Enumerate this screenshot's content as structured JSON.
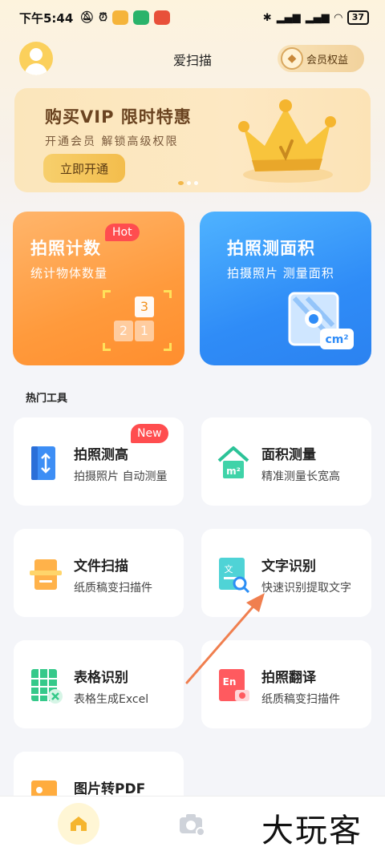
{
  "status_bar": {
    "time": "下午5:44",
    "battery": "37"
  },
  "header": {
    "title": "爱扫描",
    "vip_label": "会员权益"
  },
  "banner": {
    "title": "购买VIP 限时特惠",
    "subtitle": "开通会员 解锁高级权限",
    "button_label": "立即开通"
  },
  "feature_cards": [
    {
      "title": "拍照计数",
      "subtitle": "统计物体数量",
      "badge": "Hot",
      "blocks": [
        "3",
        "2",
        "1"
      ]
    },
    {
      "title": "拍照测面积",
      "subtitle": "拍摄照片 测量面积",
      "unit_label": "cm²"
    }
  ],
  "section_title": "热门工具",
  "tools": [
    {
      "name": "拍照测高",
      "desc": "拍摄照片 自动测量",
      "badge": "New",
      "icon": "ruler-icon"
    },
    {
      "name": "面积测量",
      "desc": "精准测量长宽高",
      "icon": "house-area-icon",
      "icon_text": "m²"
    },
    {
      "name": "文件扫描",
      "desc": "纸质稿变扫描件",
      "icon": "document-scan-icon"
    },
    {
      "name": "文字识别",
      "desc": "快速识别提取文字",
      "icon": "text-recognize-icon",
      "icon_text": "文"
    },
    {
      "name": "表格识别",
      "desc": "表格生成Excel",
      "icon": "table-excel-icon"
    },
    {
      "name": "拍照翻译",
      "desc": "纸质稿变扫描件",
      "icon": "translate-icon",
      "icon_text": "En"
    },
    {
      "name": "图片转PDF",
      "desc": "",
      "icon": "image-pdf-icon"
    }
  ],
  "watermark": "大玩客",
  "colors": {
    "accent_orange": "#ff9a3c",
    "accent_blue": "#2f8cf7",
    "badge_red": "#ff4d4f",
    "annotation_arrow": "#f07f4f"
  }
}
